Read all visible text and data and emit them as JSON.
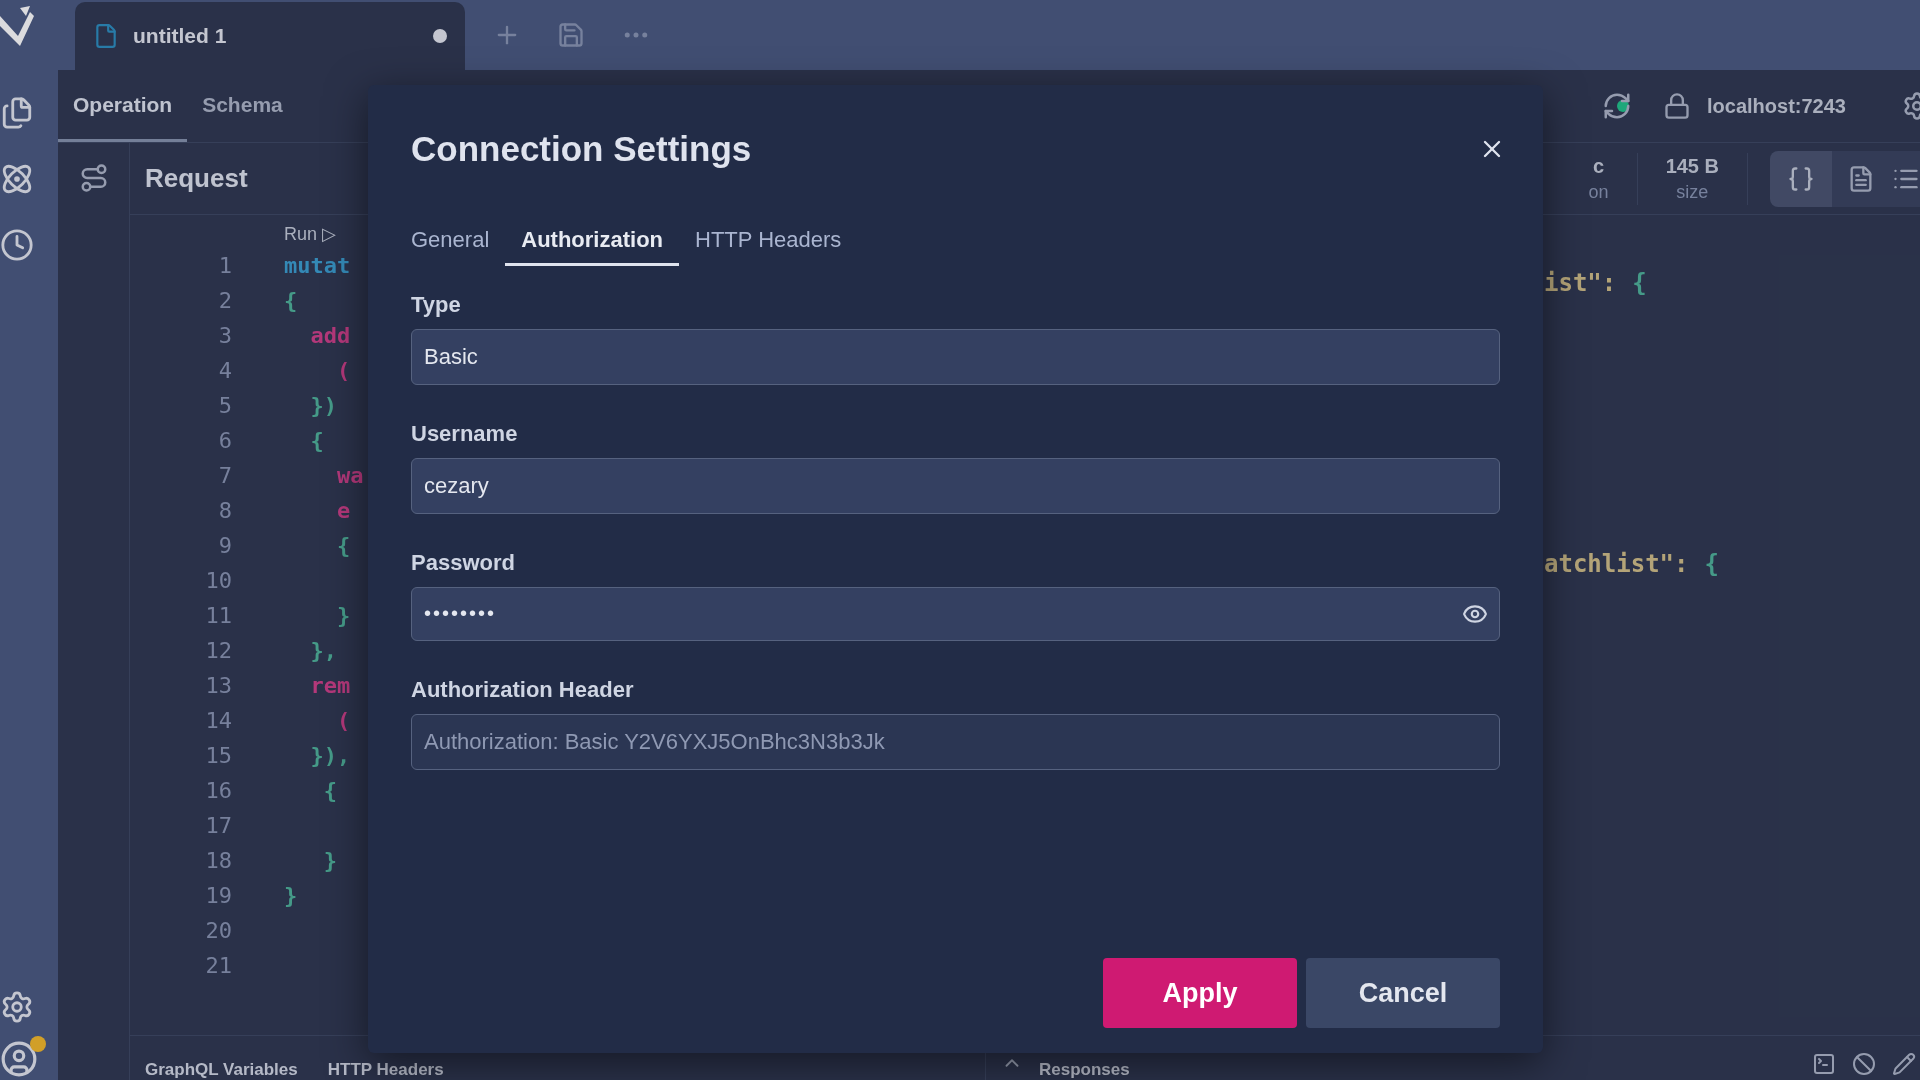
{
  "document_tab": {
    "title": "untitled 1",
    "modified": true
  },
  "view_tabs": [
    {
      "label": "Operation",
      "selected": true
    },
    {
      "label": "Schema",
      "selected": false
    }
  ],
  "connection": {
    "host": "localhost:7243"
  },
  "request": {
    "title": "Request",
    "run_label": "Run ▷",
    "lines": [
      {
        "number": "1",
        "text": "mutat",
        "kind": "keyword"
      },
      {
        "number": "2",
        "text": "{",
        "kind": "brace"
      },
      {
        "number": "3",
        "text": "  add",
        "kind": "field"
      },
      {
        "number": "4",
        "text": "    (",
        "kind": "field"
      },
      {
        "number": "5",
        "text": "  })",
        "kind": "brace"
      },
      {
        "number": "6",
        "text": "  {",
        "kind": "brace"
      },
      {
        "number": "7",
        "text": "    wa",
        "kind": "field"
      },
      {
        "number": "8",
        "text": "    e",
        "kind": "field"
      },
      {
        "number": "9",
        "text": "    {",
        "kind": "brace"
      },
      {
        "number": "10"
      },
      {
        "number": "11",
        "text": "    }",
        "kind": "brace"
      },
      {
        "number": "12",
        "text": "  },",
        "kind": "brace"
      },
      {
        "number": "13",
        "text": "  rem",
        "kind": "field"
      },
      {
        "number": "14",
        "text": "    (",
        "kind": "field"
      },
      {
        "number": "15",
        "text": "  }),",
        "kind": "brace"
      },
      {
        "number": "16",
        "text": "   {",
        "kind": "brace"
      },
      {
        "number": "17"
      },
      {
        "number": "18",
        "text": "   }",
        "kind": "brace"
      },
      {
        "number": "19",
        "text": "}",
        "kind": "brace"
      },
      {
        "number": "20"
      },
      {
        "number": "21"
      }
    ],
    "bottom_tabs": [
      "GraphQL Variables",
      "HTTP Headers"
    ]
  },
  "response": {
    "stats": [
      {
        "value": "c",
        "label": "on"
      },
      {
        "value": "145 B",
        "label": "size"
      }
    ],
    "lines": [
      {
        "key": "ist\":",
        "brace": "{"
      },
      {
        "key": "atchlist\":",
        "brace": "{"
      }
    ],
    "bottom_title": "Responses"
  },
  "dialog": {
    "title": "Connection Settings",
    "tabs": [
      {
        "label": "General",
        "selected": false
      },
      {
        "label": "Authorization",
        "selected": true
      },
      {
        "label": "HTTP Headers",
        "selected": false
      }
    ],
    "fields": [
      {
        "label": "Type",
        "value": "Basic",
        "kind": "select"
      },
      {
        "label": "Username",
        "value": "cezary",
        "kind": "text"
      },
      {
        "label": "Password",
        "value": "••••••••",
        "kind": "password"
      },
      {
        "label": "Authorization Header",
        "placeholder": "Authorization: Basic Y2V6YXJ5OnBhc3N3b3Jk",
        "kind": "text"
      }
    ],
    "buttons": [
      {
        "label": "Apply",
        "kind": "primary"
      },
      {
        "label": "Cancel",
        "kind": "secondary"
      }
    ]
  }
}
